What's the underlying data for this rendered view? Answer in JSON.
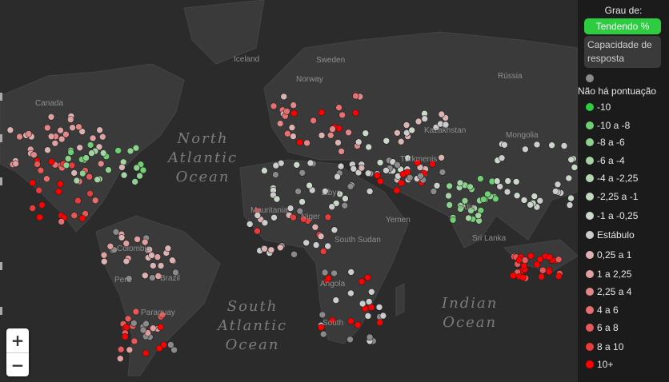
{
  "legend": {
    "title": "Grau de:",
    "active_button": "Tendendo %",
    "inactive_button": "Capacidade de resposta",
    "items": [
      {
        "label": "Não há pontuação",
        "color": "#8a8a8a"
      },
      {
        "label": "-10",
        "color": "#2ecc40"
      },
      {
        "label": "-10 a -8",
        "color": "#6fcf72"
      },
      {
        "label": "-8 a -6",
        "color": "#8ed08e"
      },
      {
        "label": "-6 a -4",
        "color": "#a5d3a3"
      },
      {
        "label": "-4 a -2,25",
        "color": "#b5d6b3"
      },
      {
        "label": "-2,25 a -1",
        "color": "#c2d8c1"
      },
      {
        "label": "-1 a -0,25",
        "color": "#cad8ca"
      },
      {
        "label": "Estábulo",
        "color": "#cccccc"
      },
      {
        "label": "0,25 a 1",
        "color": "#dcb3b3"
      },
      {
        "label": "1 a 2,25",
        "color": "#e0a0a0"
      },
      {
        "label": "2,25 a 4",
        "color": "#e38888"
      },
      {
        "label": "4 a 6",
        "color": "#e67070"
      },
      {
        "label": "6 a 8",
        "color": "#e85858"
      },
      {
        "label": "8 a 10",
        "color": "#eb3c3c"
      },
      {
        "label": "10+",
        "color": "#ff0000"
      }
    ]
  },
  "map": {
    "oceans": [
      {
        "name": "North Atlantic Ocean",
        "lines": "North\nAtlantic\nOcean"
      },
      {
        "name": "South Atlantic Ocean",
        "lines": "South\nAtlantic\nOcean"
      },
      {
        "name": "Indian Ocean",
        "lines": "Indian\nOcean"
      }
    ],
    "places": [
      "Iceland",
      "Sweden",
      "Norway",
      "Rússia",
      "Canada",
      "Kazakhstan",
      "Mongolia",
      "Libya",
      "Mauritania",
      "Niger",
      "South Sudan",
      "Yemen",
      "Turkmenis",
      "India",
      "Sri Lanka",
      "Colombia",
      "Brazil",
      "Peru",
      "Paraguay",
      "Angola",
      "South"
    ],
    "zoom_in": "+",
    "zoom_out": "−"
  }
}
